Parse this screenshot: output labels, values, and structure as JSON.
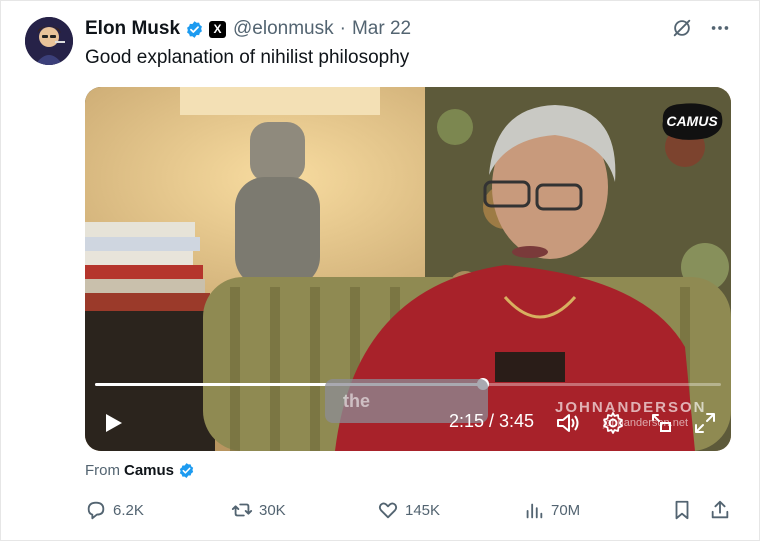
{
  "author": {
    "name": "Elon Musk",
    "handle": "@elonmusk",
    "separator": "·",
    "date": "Mar 22",
    "badge_letter": "X"
  },
  "tweet": {
    "text": "Good explanation of nihilist philosophy"
  },
  "video": {
    "progress_fraction": 0.62,
    "current_time": "2:15",
    "duration": "3:45",
    "time_display": "2:15 / 3:45",
    "subtitle_text": "the",
    "watermark_name": "JOHNANDERSON",
    "watermark_site": "johnanderson.net",
    "logo_text": "CAMUS"
  },
  "source": {
    "prefix": "From",
    "name": "Camus"
  },
  "actions": {
    "replies": "6.2K",
    "reposts": "30K",
    "likes": "145K",
    "views": "70M"
  },
  "colors": {
    "verified_blue": "#1d9bf0",
    "text_primary": "#0f1419",
    "text_secondary": "#536471"
  },
  "icons": [
    "grok-slash-icon",
    "more-icon",
    "play-icon",
    "volume-icon",
    "settings-gear-icon",
    "pip-icon",
    "fullscreen-icon",
    "reply-icon",
    "repost-icon",
    "like-icon",
    "views-icon",
    "bookmark-icon",
    "share-icon"
  ]
}
